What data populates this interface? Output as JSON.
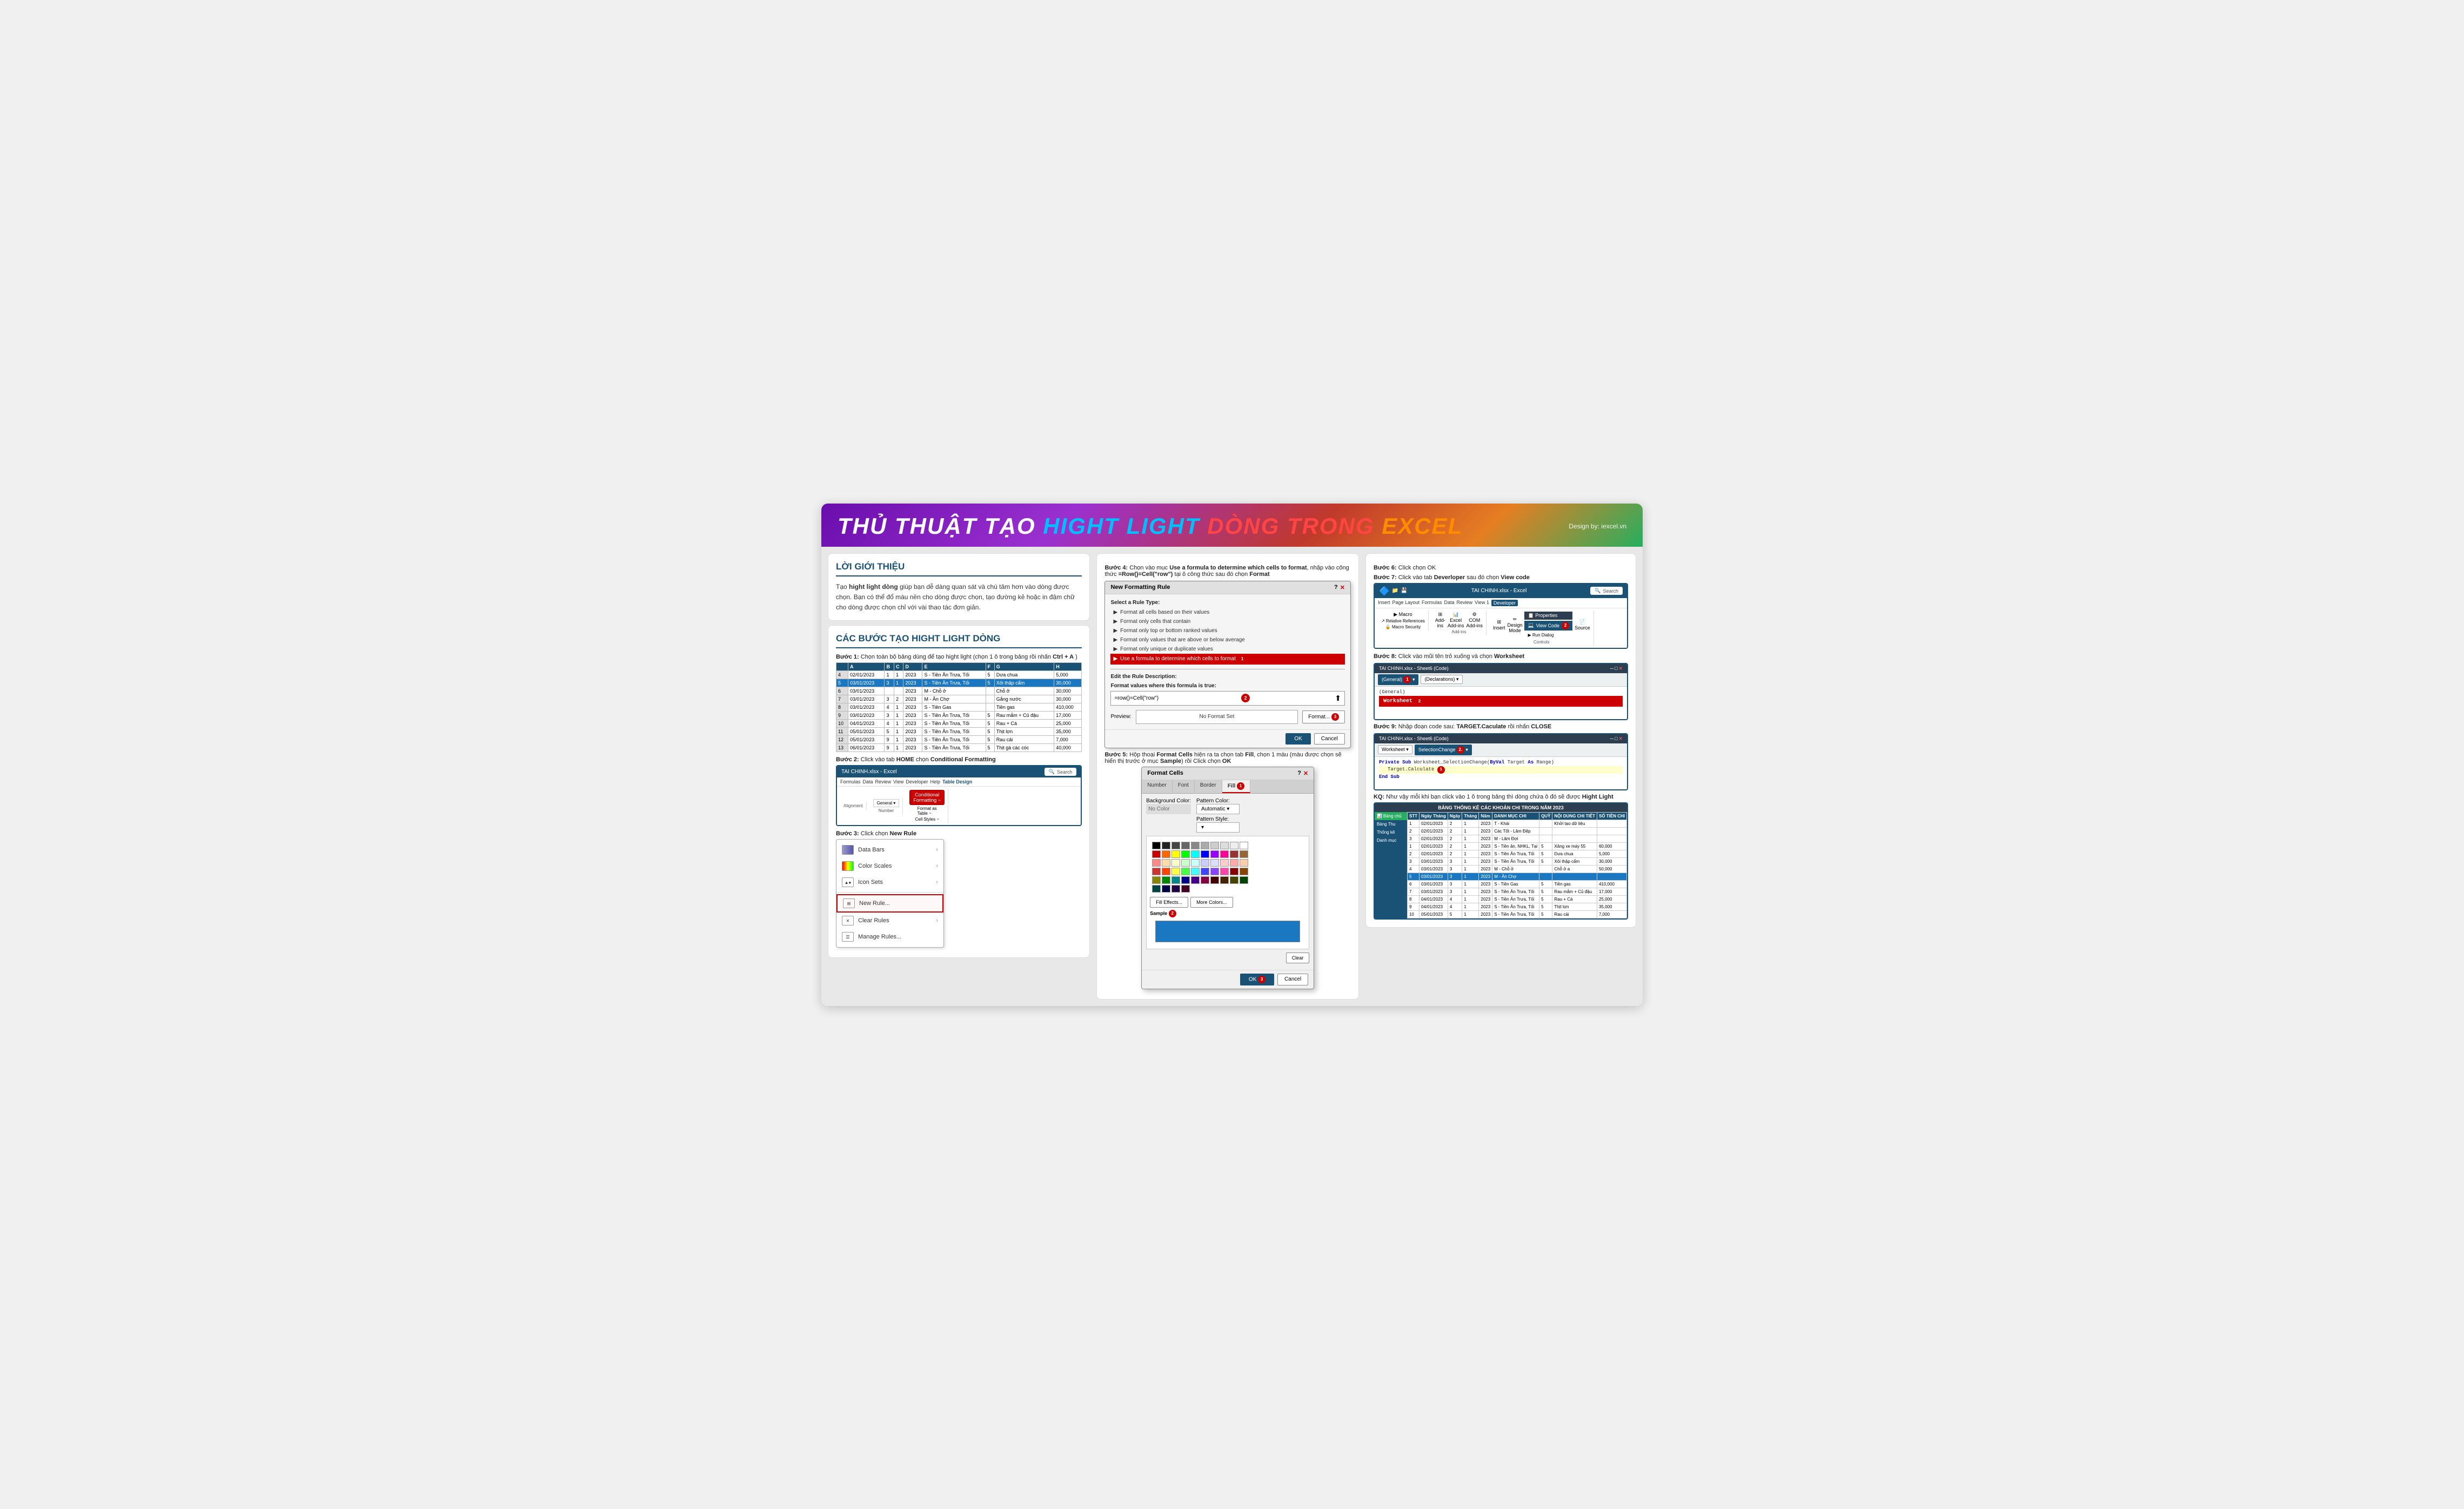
{
  "header": {
    "title_part1": "THỦ THUẬT TẠO",
    "title_part2": "HIGHT LIGHT",
    "title_part3": "DÒNG TRONG",
    "title_part4": "EXCEL",
    "design_by": "Design by: iexcel.vn"
  },
  "intro": {
    "section_title": "LỜI GIỚI THIỆU",
    "text": "Tạo hight light dòng giúp bạn dễ dàng quan sát và chú tâm hơn vào dòng được chọn. Bạn có thể đổ màu nền cho dòng được chọn, tạo đường kẻ hoặc in đậm chữ cho dòng được chọn chỉ với vài thao tác đơn giản."
  },
  "steps_section": {
    "section_title": "CÁC BƯỚC TẠO HIGHT LIGHT DÒNG",
    "step1": "Bước 1: Chọn toàn bộ bảng dùng để tạo hight light (chọn 1 ô trong bảng rồi nhấn Ctrl + A )",
    "step2": "Bước 2: Click vào tab HOME chọn Conditional Formatting",
    "step3": "Bước 3: Click chọn New Rule"
  },
  "mid_section": {
    "step4": "Bước 4: Chọn vào mục Use a formula to determine which cells to format, nhập vào công thức =Row()=Cell(\"row\") tại ô công thức sau đó chọn Format",
    "step5": "Bước 5: Hộp thoại Format Cells hiện ra ta chọn tab Fill, chọn 1 màu (màu được chọn sẽ hiển thị trước ở mục Sample) rồi Click chọn OK",
    "dialog_title": "New Formatting Rule",
    "rule_types": [
      "Format all cells based on their values",
      "Format only cells that contain",
      "Format only top or bottom ranked values",
      "Format only values that are above or below average",
      "Format only unique or duplicate values",
      "Use a formula to determine which cells to format"
    ],
    "formula_label": "Format values where this formula is true:",
    "formula_value": "=row()=Cell(\"row\")",
    "preview_label": "Preview:",
    "no_format_set": "No Format Set",
    "format_btn": "Format...",
    "ok_btn": "OK",
    "cancel_btn": "Cancel",
    "format_cells_title": "Format Cells",
    "tabs": [
      "Number",
      "Font",
      "Border",
      "Fill"
    ],
    "bg_color_label": "Background Color:",
    "no_color": "No Color",
    "pattern_color_label": "Pattern Color:",
    "automatic": "Automatic",
    "pattern_style_label": "Pattern Style:",
    "fill_effects_btn": "Fill Effects...",
    "more_colors_btn": "More Colors...",
    "sample_label": "Sample",
    "clear_btn": "Clear"
  },
  "right_section": {
    "step6": "Bước 6: Click chọn OK",
    "step7": "Bước 7: Click vào tab Deverloper sau đó chọn View code",
    "step8": "Bước 8: Click vào mũi tên trỏ xuống và chọn Worksheet",
    "step9": "Bước 9: Nhập đoạn code sau: TARGET.Caculate rồi nhấn CLOSE",
    "result": "KQ: Như vậy mỗi khi bạn click vào 1 ô trong bảng thì dòng chứa ô đó sẽ được Hight Light",
    "excel_title": "TAI CHINH.xlsx - Excel",
    "search_placeholder": "Search",
    "tabs": [
      "Insert",
      "Page Layout",
      "Formulas",
      "Data",
      "Review",
      "View 1",
      "Developer"
    ],
    "vba_title": "TAI CHINH.xlsx - Sheet6 (Code)",
    "general_option": "(General)",
    "worksheet_option": "Worksheet",
    "vba_code": "Private Sub Worksheet_SelectionChange(ByVal Target As Range)\n    Target.Calculate\nEnd Sub",
    "selection_change": "SelectionChange",
    "dropdown_general": "(General)",
    "final_table_title": "BẢNG THỐNG KÊ CÁC KHOẢN CHI TRONG NĂM 2023",
    "add_ins_label": "Add-ins",
    "com_label": "COM Add-ins",
    "source_label": "Source"
  },
  "dropdown_items": [
    {
      "label": "Data Bars",
      "has_arrow": true
    },
    {
      "label": "Color Scales",
      "has_arrow": true
    },
    {
      "label": "Icon Sets",
      "has_arrow": true
    },
    {
      "label": "New Rule...",
      "highlighted": true
    },
    {
      "label": "Clear Rules",
      "has_arrow": true
    },
    {
      "label": "Manage Rules..."
    }
  ],
  "colors": {
    "accent": "#1a5276",
    "red": "#c00",
    "blue": "#1a78c2",
    "purple": "#6a0dad"
  }
}
